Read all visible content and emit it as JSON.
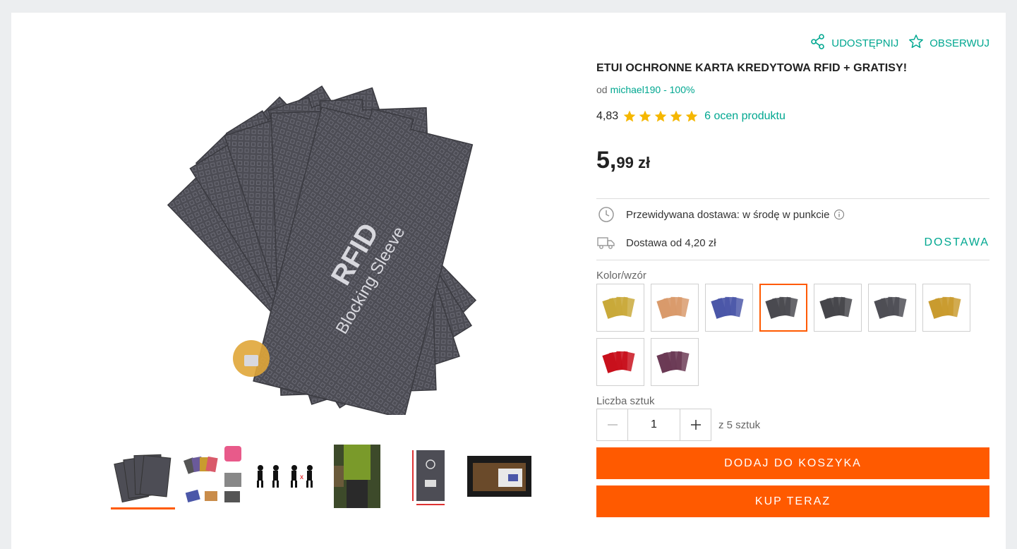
{
  "actions": {
    "share_label": "UDOSTĘPNIJ",
    "watch_label": "OBSERWUJ"
  },
  "product": {
    "title": "ETUI OCHRONNE KARTA KREDYTOWA RFID + GRATISY!",
    "seller_prefix": "od",
    "seller": "michael190 - 100%",
    "rating_value": "4,83",
    "rating_stars": 5,
    "rating_link": "6 ocen produktu",
    "price_main": "5,",
    "price_fraction": "99 zł"
  },
  "main_image": {
    "text1": "RFID",
    "text2": "Blocking Sleeve"
  },
  "delivery": {
    "estimate": "Przewidywana dostawa: w środę w punkcie",
    "cost": "Dostawa od 4,20 zł",
    "link": "DOSTAWA"
  },
  "variants": {
    "label": "Kolor/wzór",
    "colors": [
      "#c9a93a",
      "#d99a6b",
      "#4b57a8",
      "#4a4a50",
      "#45454a",
      "#4e4e55",
      "#c99b2f",
      "#c8101c",
      "#6b3a55"
    ],
    "selected_index": 3
  },
  "quantity": {
    "label": "Liczba sztuk",
    "value": "1",
    "of_text": "z 5 sztuk"
  },
  "buttons": {
    "add_to_cart": "DODAJ DO KOSZYKA",
    "buy_now": "KUP TERAZ"
  },
  "colors": {
    "accent": "#00a790",
    "brand_orange": "#ff5a00",
    "star": "#f5b700"
  }
}
